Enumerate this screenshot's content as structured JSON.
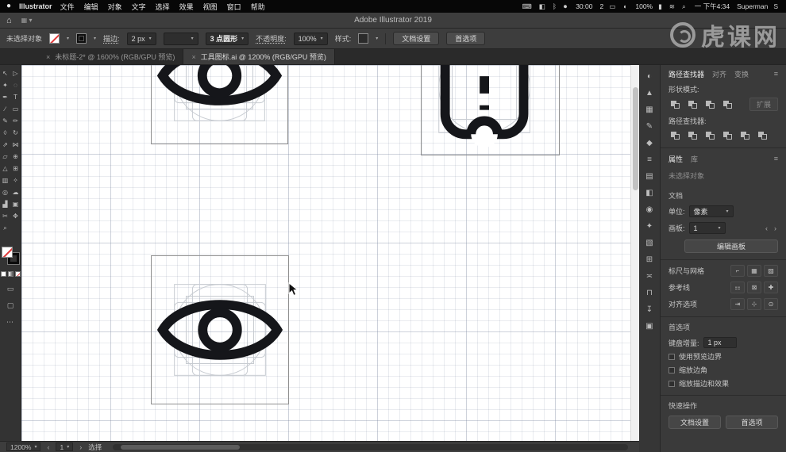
{
  "menubar": {
    "apple_logo": "●",
    "app_name": "Illustrator",
    "menus": [
      "文件",
      "编辑",
      "对象",
      "文字",
      "选择",
      "效果",
      "视图",
      "窗口",
      "帮助"
    ],
    "status": [
      {
        "name": "keyboard-icon",
        "glyph": "⌨"
      },
      {
        "name": "mirror-display-icon",
        "glyph": "◧"
      },
      {
        "name": "bluetooth-icon",
        "glyph": "ᛒ"
      },
      {
        "name": "screen-record-icon",
        "glyph": "⏺"
      },
      {
        "name": "record-timer-text",
        "text": "30:00"
      },
      {
        "name": "workspace-count-text",
        "text": "2"
      },
      {
        "name": "airplay-icon",
        "glyph": "▭"
      },
      {
        "name": "volume-icon",
        "glyph": "◖"
      },
      {
        "name": "battery-percent-text",
        "text": "100%"
      },
      {
        "name": "battery-icon",
        "glyph": "▮"
      },
      {
        "name": "wifi-icon",
        "glyph": "≋"
      },
      {
        "name": "spotlight-icon",
        "glyph": "⌕"
      },
      {
        "name": "datetime-text",
        "text": "一 下午4:34"
      },
      {
        "name": "username-text",
        "text": "Superman"
      },
      {
        "name": "input-method-icon",
        "glyph": "S"
      }
    ]
  },
  "titlebar": {
    "title": "Adobe Illustrator 2019"
  },
  "controlbar": {
    "no_selection": "未选择对象",
    "stroke_label": "描边:",
    "stroke_value": "2 px",
    "brush_value": "3 点圆形",
    "opacity_label": "不透明度:",
    "opacity_value": "100%",
    "style_label": "样式:",
    "doc_setup_button": "文档设置",
    "preferences_button": "首选项"
  },
  "doc_tabs": [
    {
      "label": "未标题-2* @ 1600% (RGB/GPU 预览)"
    },
    {
      "label": "工具图标.ai @ 1200% (RGB/GPU 预览)"
    }
  ],
  "toolbar": {
    "tools": [
      {
        "name": "selection-tool",
        "glyph": "↖"
      },
      {
        "name": "direct-selection-tool",
        "glyph": "▷"
      },
      {
        "name": "magic-wand-tool",
        "glyph": "✦"
      },
      {
        "name": "lasso-tool",
        "glyph": "◌"
      },
      {
        "name": "pen-tool",
        "glyph": "✒"
      },
      {
        "name": "type-tool",
        "glyph": "T"
      },
      {
        "name": "line-segment-tool",
        "glyph": "∕"
      },
      {
        "name": "rectangle-tool",
        "glyph": "▭"
      },
      {
        "name": "paintbrush-tool",
        "glyph": "✎"
      },
      {
        "name": "shaper-tool",
        "glyph": "✏"
      },
      {
        "name": "eraser-tool",
        "glyph": "◊"
      },
      {
        "name": "rotate-tool",
        "glyph": "↻"
      },
      {
        "name": "scale-tool",
        "glyph": "⇗"
      },
      {
        "name": "width-tool",
        "glyph": "⋈"
      },
      {
        "name": "free-transform-tool",
        "glyph": "▱"
      },
      {
        "name": "shape-builder-tool",
        "glyph": "⊕"
      },
      {
        "name": "perspective-grid-tool",
        "glyph": "△"
      },
      {
        "name": "mesh-tool",
        "glyph": "⊞"
      },
      {
        "name": "gradient-tool",
        "glyph": "▥"
      },
      {
        "name": "eyedropper-tool",
        "glyph": "✧"
      },
      {
        "name": "blend-tool",
        "glyph": "◎"
      },
      {
        "name": "symbol-sprayer-tool",
        "glyph": "☁"
      },
      {
        "name": "column-graph-tool",
        "glyph": "▟"
      },
      {
        "name": "artboard-tool",
        "glyph": "▣"
      },
      {
        "name": "slice-tool",
        "glyph": "✂"
      },
      {
        "name": "hand-tool",
        "glyph": "✥"
      },
      {
        "name": "zoom-tool",
        "glyph": "⌕"
      }
    ]
  },
  "dock": {
    "icons": [
      {
        "name": "color-panel-icon",
        "glyph": "◐"
      },
      {
        "name": "color-guide-panel-icon",
        "glyph": "▲"
      },
      {
        "name": "swatches-panel-icon",
        "glyph": "▦"
      },
      {
        "name": "brushes-panel-icon",
        "glyph": "✎"
      },
      {
        "name": "symbols-panel-icon",
        "glyph": "◆"
      },
      {
        "name": "stroke-panel-icon",
        "glyph": "≡"
      },
      {
        "name": "gradient-panel-icon",
        "glyph": "▤"
      },
      {
        "name": "transparency-panel-icon",
        "glyph": "◧"
      },
      {
        "name": "appearance-panel-icon",
        "glyph": "◉"
      },
      {
        "name": "graphic-styles-panel-icon",
        "glyph": "✦"
      },
      {
        "name": "layers-panel-icon",
        "glyph": "▧"
      },
      {
        "name": "artboards-panel-icon",
        "glyph": "⊞"
      },
      {
        "name": "align-panel-icon",
        "glyph": "≍"
      },
      {
        "name": "pathfinder-panel-icon",
        "glyph": "⊓"
      },
      {
        "name": "asset-export-panel-icon",
        "glyph": "↧"
      },
      {
        "name": "libraries-panel-icon",
        "glyph": "▣"
      }
    ]
  },
  "pathfinder": {
    "tabs": [
      "路径查找器",
      "对齐",
      "变换"
    ],
    "shape_modes_label": "形状模式:",
    "shape_modes": [
      {
        "name": "unite-icon"
      },
      {
        "name": "minus-front-icon"
      },
      {
        "name": "intersect-icon"
      },
      {
        "name": "exclude-icon"
      }
    ],
    "expand_button": "扩展",
    "pathfinders_label": "路径查找器:",
    "pathfinders": [
      {
        "name": "divide-icon"
      },
      {
        "name": "trim-icon"
      },
      {
        "name": "merge-icon"
      },
      {
        "name": "crop-icon"
      },
      {
        "name": "outline-icon"
      },
      {
        "name": "minus-back-icon"
      }
    ]
  },
  "properties": {
    "tabs": [
      "属性",
      "库"
    ],
    "no_selection": "未选择对象",
    "document_section": "文档",
    "units_label": "单位:",
    "units_value": "像素",
    "artboard_label": "画板:",
    "artboard_value": "1",
    "edit_artboards_button": "编辑画板",
    "rulers_grids_label": "标尺与网格",
    "rulers_icons": [
      {
        "name": "show-rulers-icon",
        "glyph": "⌐"
      },
      {
        "name": "show-grid-icon",
        "glyph": "▦"
      },
      {
        "name": "show-transparency-grid-icon",
        "glyph": "▨"
      }
    ],
    "guides_label": "参考线",
    "guides_icons": [
      {
        "name": "show-guides-icon",
        "glyph": "⚏"
      },
      {
        "name": "lock-guides-icon",
        "glyph": "⊠"
      },
      {
        "name": "smart-guides-icon",
        "glyph": "✚"
      }
    ],
    "snap_label": "对齐选项",
    "snap_icons": [
      {
        "name": "snap-to-grid-icon",
        "glyph": "⇥"
      },
      {
        "name": "snap-to-pixel-icon",
        "glyph": "⊹"
      },
      {
        "name": "snap-to-point-icon",
        "glyph": "⊙"
      }
    ],
    "preferences_section": "首选项",
    "keyboard_increment_label": "键盘增量:",
    "keyboard_increment_value": "1 px",
    "checkboxes": [
      "使用预览边界",
      "缩放边角",
      "缩放描边和效果"
    ],
    "quick_actions_label": "快速操作",
    "quick_actions": [
      {
        "name": "doc-setup-button",
        "label": "文档设置"
      },
      {
        "name": "preferences-button",
        "label": "首选项"
      }
    ]
  },
  "statusbar": {
    "zoom": "1200%",
    "artboard_value": "1",
    "status_text": "选择"
  },
  "watermark": {
    "text": "虎课网"
  }
}
